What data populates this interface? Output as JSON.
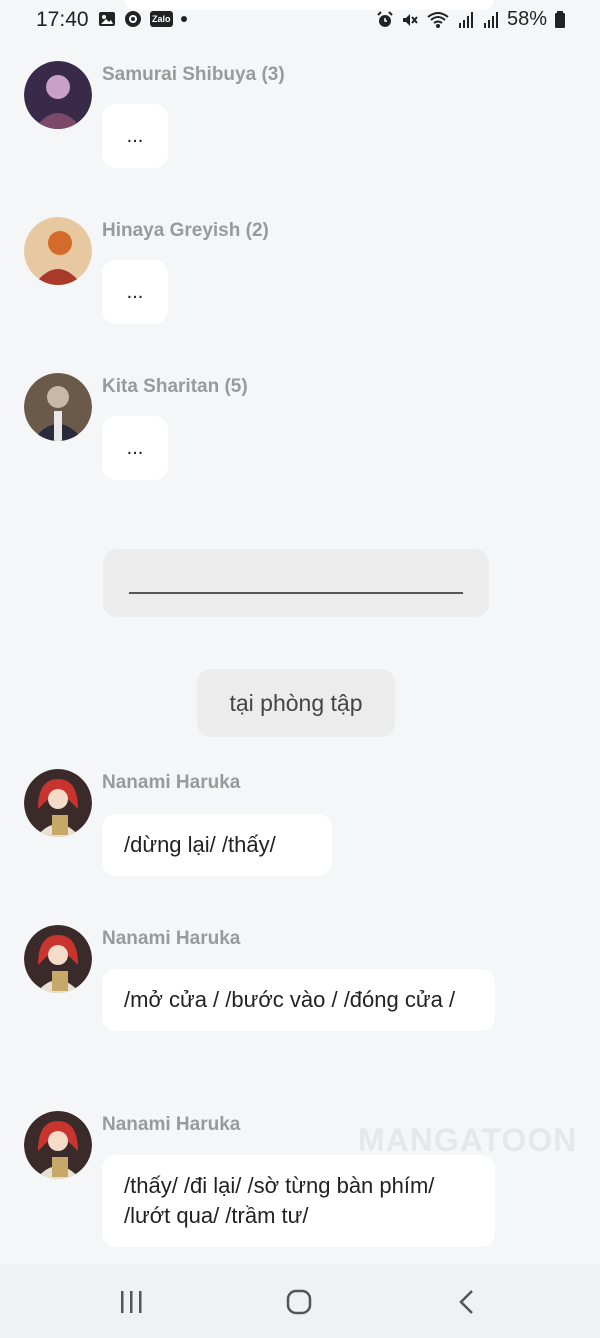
{
  "status_bar": {
    "time": "17:40",
    "left_icons": [
      "gallery-icon",
      "messenger-icon",
      "zalo-icon",
      "notification-dot"
    ],
    "zalo_label": "Zalo",
    "right_icons": [
      "alarm-icon",
      "mute-icon",
      "wifi-icon",
      "signal-icon",
      "signal-icon"
    ],
    "battery": "58%"
  },
  "messages": [
    {
      "sender": "Samurai Shibuya (3)",
      "text": "...",
      "avatar_colors": [
        "#3a2a4a",
        "#c9a1c8"
      ]
    },
    {
      "sender": "Hinaya Greyish (2)",
      "text": "...",
      "avatar_colors": [
        "#d46a2c",
        "#a83a2a"
      ]
    },
    {
      "sender": "Kita Sharitan (5)",
      "text": "...",
      "avatar_colors": [
        "#6b5a4a",
        "#2a2a3a"
      ]
    },
    {
      "sender": "Nanami Haruka",
      "text": "/dừng lại/ /thấy/",
      "avatar_colors": [
        "#c8342e",
        "#e8d8a8"
      ]
    },
    {
      "sender": "Nanami Haruka",
      "text": "/mở cửa / /bước vào / /đóng cửa /",
      "avatar_colors": [
        "#c8342e",
        "#e8d8a8"
      ]
    },
    {
      "sender": "Nanami Haruka",
      "text": "/thấy/ /đi lại/ /sờ từng bàn phím/ /lướt qua/ /trầm tư/",
      "avatar_colors": [
        "#c8342e",
        "#e8d8a8"
      ]
    }
  ],
  "scene": {
    "label": "tại phòng tập"
  },
  "watermark": "MANGATOON",
  "nav": [
    "recent-apps-icon",
    "home-icon",
    "back-icon"
  ]
}
